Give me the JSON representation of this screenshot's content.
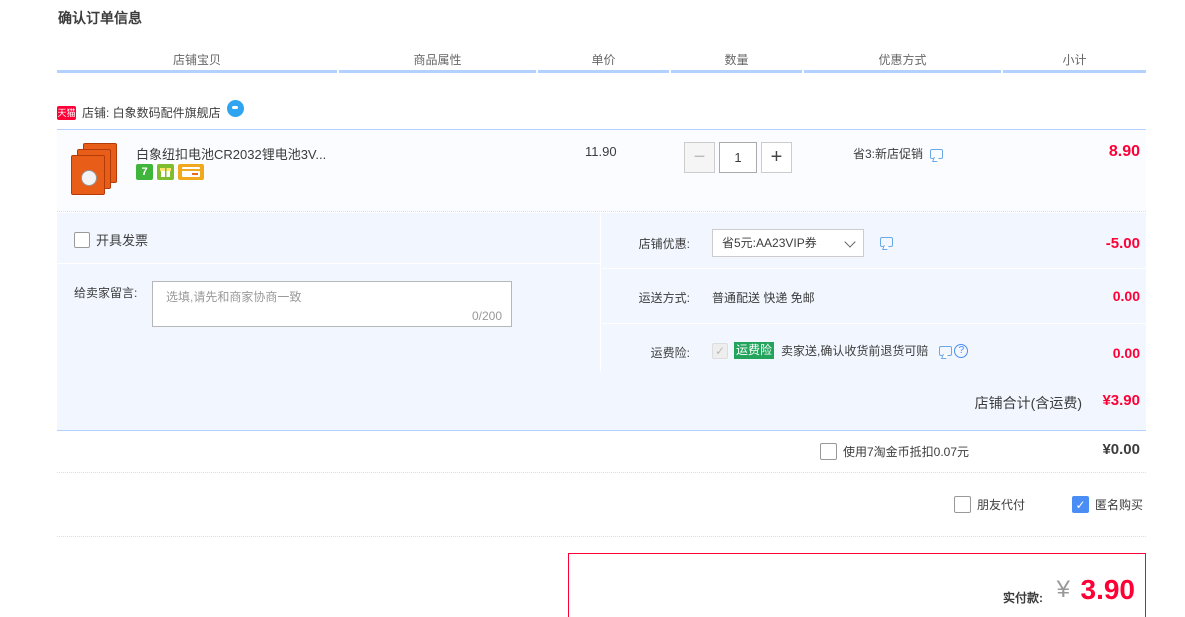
{
  "page_title": "确认订单信息",
  "columns": [
    "店铺宝贝",
    "商品属性",
    "单价",
    "数量",
    "优惠方式",
    "小计"
  ],
  "shop": {
    "badge": "天猫",
    "label": "店铺: 白象数码配件旗舰店"
  },
  "item": {
    "title": "白象纽扣电池CR2032锂电池3V...",
    "service_icons": [
      "seven-day-return-icon",
      "gift-icon",
      "credit-card-icon"
    ],
    "service_7": "7",
    "unit_price": "11.90",
    "quantity": "1",
    "minus": "−",
    "plus": "+",
    "promo": "省3:新店促销",
    "subtotal": "8.90"
  },
  "invoice_label": "开具发票",
  "message": {
    "label": "给卖家留言:",
    "placeholder": "选填,请先和商家协商一致",
    "count": "0/200"
  },
  "shop_discount": {
    "label": "店铺优惠:",
    "selected": "省5元:AA23VIP券",
    "value": "-5.00"
  },
  "shipping": {
    "label": "运送方式:",
    "text": "普通配送 快递 免邮",
    "value": "0.00"
  },
  "insurance": {
    "label": "运费险:",
    "badge": "运费险",
    "text": "卖家送,确认收货前退货可赔",
    "help": "?",
    "value": "0.00"
  },
  "shop_total": {
    "label": "店铺合计(含运费)",
    "value": "¥3.90"
  },
  "coins": {
    "label": "使用7淘金币抵扣0.07元",
    "value": "¥0.00"
  },
  "options": {
    "friend_pay": "朋友代付",
    "anonymous": "匿名购买",
    "anonymous_checked": true
  },
  "payment": {
    "label": "实付款:",
    "yen": "¥",
    "value": "3.90"
  },
  "colors": {
    "accent_red": "#ff0036",
    "header_border": "#b2d1ff",
    "panel_bg": "#f2f7ff",
    "checkbox_blue": "#4a8ef5",
    "insurance_green": "#22a45d"
  }
}
